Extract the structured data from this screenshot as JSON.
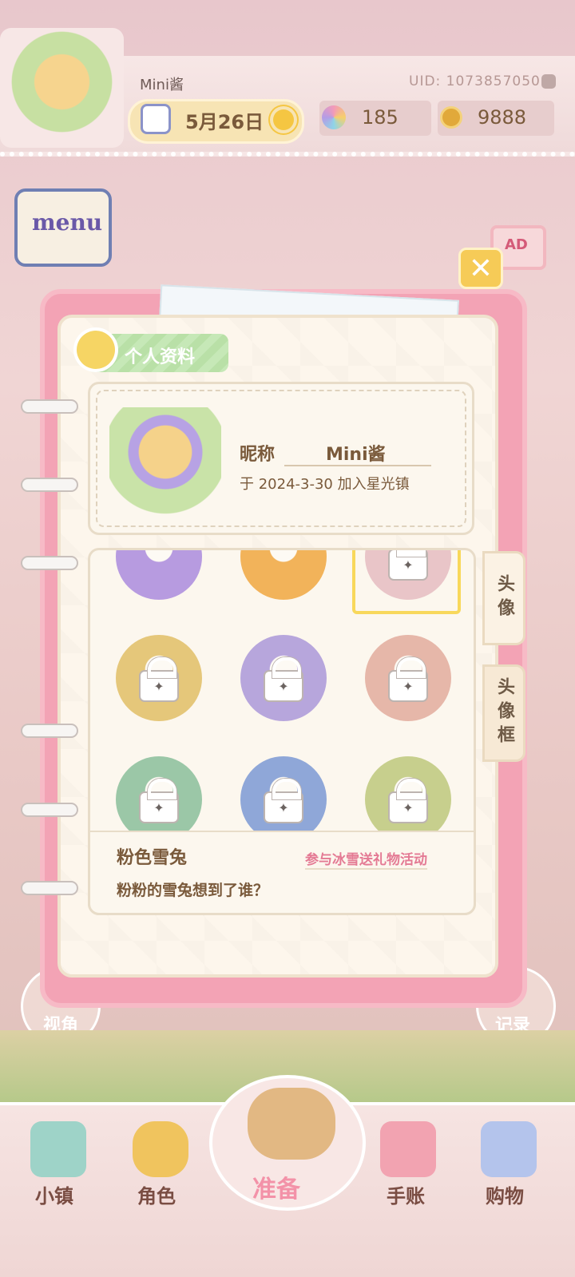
{
  "header": {
    "nickname": "Mini酱",
    "uid": "UID: 1073857050",
    "date": "5月26日",
    "gems": "185",
    "coins": "9888"
  },
  "menu_label": "menu",
  "ad_label": "AD",
  "close_label": "✕",
  "profile": {
    "section_title": "个人资料",
    "nickname_label": "昵称",
    "nickname_value": "Mini酱",
    "join_text": "于 2024-3-30 加入星光镇"
  },
  "selected_item": {
    "name": "粉色雪兔",
    "source": "参与冰雪送礼物活动",
    "description": "粉粉的雪兔想到了谁？"
  },
  "side_tabs": [
    "头像",
    "头像框"
  ],
  "corner_buttons": {
    "left": "视角",
    "right": "记录"
  },
  "bottom_nav": [
    "小镇",
    "角色",
    "准备",
    "手账",
    "购物"
  ],
  "avatars": [
    {
      "name": "purple-haired-girl",
      "locked": false,
      "color": "#b79be0"
    },
    {
      "name": "blonde-girl",
      "locked": false,
      "color": "#f2b35a"
    },
    {
      "name": "pink-snow-bunny",
      "locked": true,
      "color": "#e9c5c8"
    },
    {
      "name": "golden-crest",
      "locked": true,
      "color": "#e5c77a"
    },
    {
      "name": "lavender-cloud",
      "locked": true,
      "color": "#b7a6dc"
    },
    {
      "name": "pink-flower",
      "locked": true,
      "color": "#e6b7a9"
    },
    {
      "name": "teal-star",
      "locked": true,
      "color": "#9bc7a7"
    },
    {
      "name": "grey-cat",
      "locked": true,
      "color": "#8fa7d8"
    },
    {
      "name": "green-fairy",
      "locked": true,
      "color": "#c7cf8d"
    }
  ]
}
